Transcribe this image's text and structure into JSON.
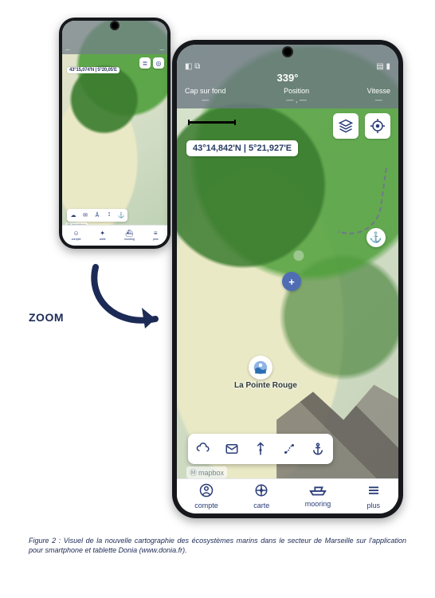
{
  "zoom_label": "ZOOM",
  "caption": "Figure 2 : Visuel de la nouvelle cartographie des écosystèmes marins dans le secteur de Marseille sur l'application pour smartphone et tablette Donia (www.donia.fr).",
  "mapbox_badge": "mapbox",
  "small_phone": {
    "status_left": "—",
    "status_right": "—",
    "coords": "43°15,074'N | 5°20,05'E",
    "tabs": [
      {
        "label": "compte"
      },
      {
        "label": "carte"
      },
      {
        "label": "mooring"
      },
      {
        "label": "plus"
      }
    ]
  },
  "large_phone": {
    "heading": "339°",
    "status": {
      "cap": {
        "label": "Cap sur fond",
        "value": "—"
      },
      "position": {
        "label": "Position",
        "value": "— , —"
      },
      "vitesse": {
        "label": "Vitesse",
        "value": "—"
      }
    },
    "coords": "43°14,842'N | 5°21,927'E",
    "poi_label": "La Pointe Rouge",
    "tabs": [
      {
        "label": "compte"
      },
      {
        "label": "carte"
      },
      {
        "label": "mooring"
      },
      {
        "label": "plus"
      }
    ]
  },
  "icons": {
    "layers": "≣",
    "target": "◎",
    "anchor": "⚓",
    "plus": "+",
    "weather": "☁",
    "mail": "✉",
    "compass": "Å",
    "route": "⟟",
    "account": "☺",
    "map": "✦",
    "boat": "⛴",
    "menu": "≡",
    "pin": "📍"
  }
}
